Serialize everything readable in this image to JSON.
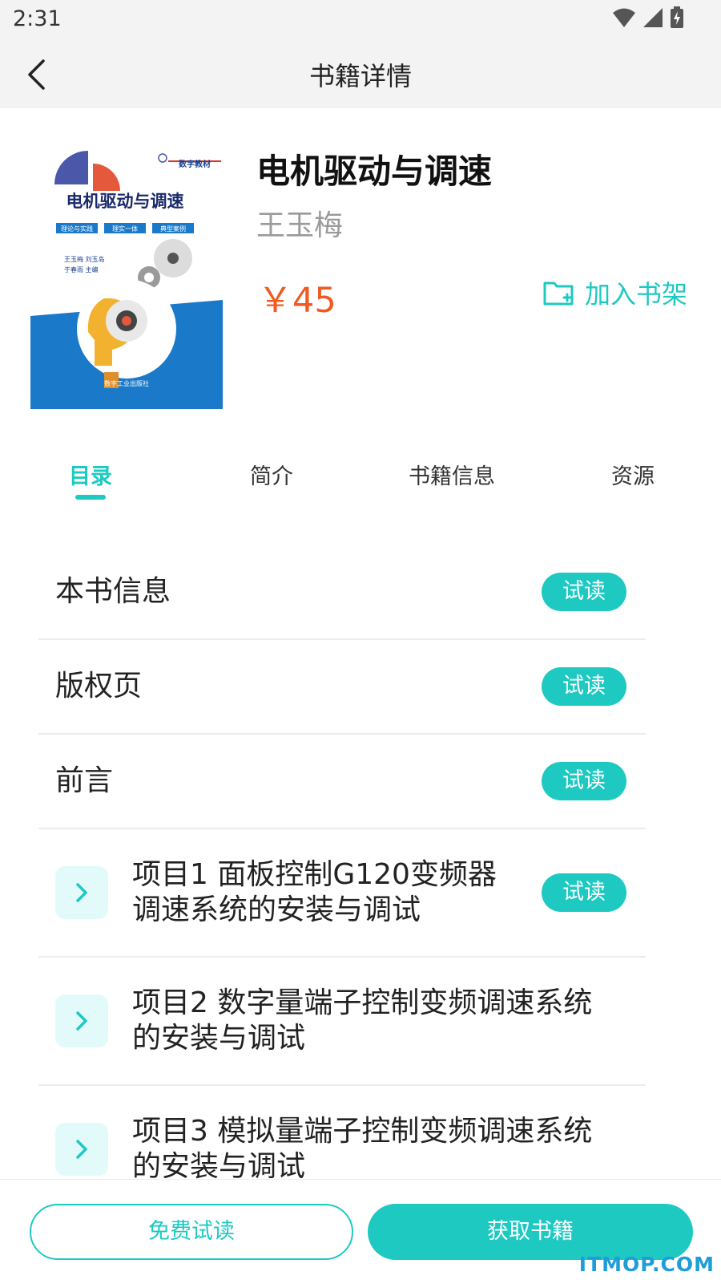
{
  "status_bar": {
    "time": "2:31"
  },
  "header": {
    "title": "书籍详情"
  },
  "book": {
    "title": "电机驱动与调速",
    "author": "王玉梅",
    "price": "￥45",
    "add_to_shelf": "加入书架"
  },
  "cover": {
    "badge": "数字教材",
    "title": "电机驱动与调速",
    "tags": [
      "理论与实践",
      "理实一体",
      "典型案例"
    ],
    "authors_line1": "王玉梅 刘玉岛",
    "authors_line2": "于春雨 主编",
    "publisher": "数字工业出版社"
  },
  "tabs": [
    {
      "label": "目录",
      "active": true
    },
    {
      "label": "简介",
      "active": false
    },
    {
      "label": "书籍信息",
      "active": false
    },
    {
      "label": "资源",
      "active": false
    }
  ],
  "catalog": [
    {
      "label": "本书信息",
      "trial": "试读"
    },
    {
      "label": "版权页",
      "trial": "试读"
    },
    {
      "label": "前言",
      "trial": "试读"
    },
    {
      "line1": "项目1 面板控制G120变频器",
      "line2": "调速系统的安装与调试",
      "trial": "试读"
    },
    {
      "line1": "项目2 数字量端子控制变频调速系统",
      "line2": "的安装与调试"
    },
    {
      "line1": "项目3 模拟量端子控制变频调速系统",
      "line2": "的安装与调试"
    }
  ],
  "actions": {
    "free_read": "免费试读",
    "get_book": "获取书籍"
  },
  "watermark": "ITMOP.COM",
  "colors": {
    "accent": "#1ec9c2",
    "price": "#f05a22",
    "cover_blue": "#1a7ac9"
  }
}
